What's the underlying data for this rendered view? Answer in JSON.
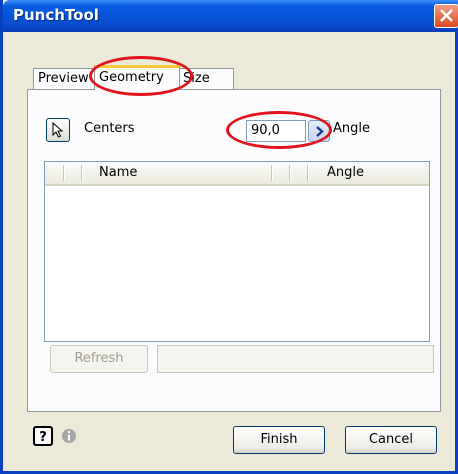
{
  "window": {
    "title": "PunchTool",
    "close_icon": "close-icon"
  },
  "tabs": [
    {
      "label": "Preview"
    },
    {
      "label": "Geometry",
      "active": true
    },
    {
      "label": "Size"
    }
  ],
  "geometry": {
    "centers_label": "Centers",
    "select_icon": "cursor-arrow-icon",
    "angle_value": "90,0",
    "angle_label": "Angle"
  },
  "list": {
    "columns": [
      "Name",
      "Angle"
    ],
    "rows": []
  },
  "refresh": {
    "label": "Refresh",
    "enabled": false
  },
  "footer": {
    "help_icon": "help-icon",
    "info_icon": "info-icon",
    "finish_label": "Finish",
    "cancel_label": "Cancel"
  },
  "colors": {
    "highlight": "#e0141c",
    "title_bar": "#0553d7",
    "dialog_bg": "#ece9d8"
  }
}
